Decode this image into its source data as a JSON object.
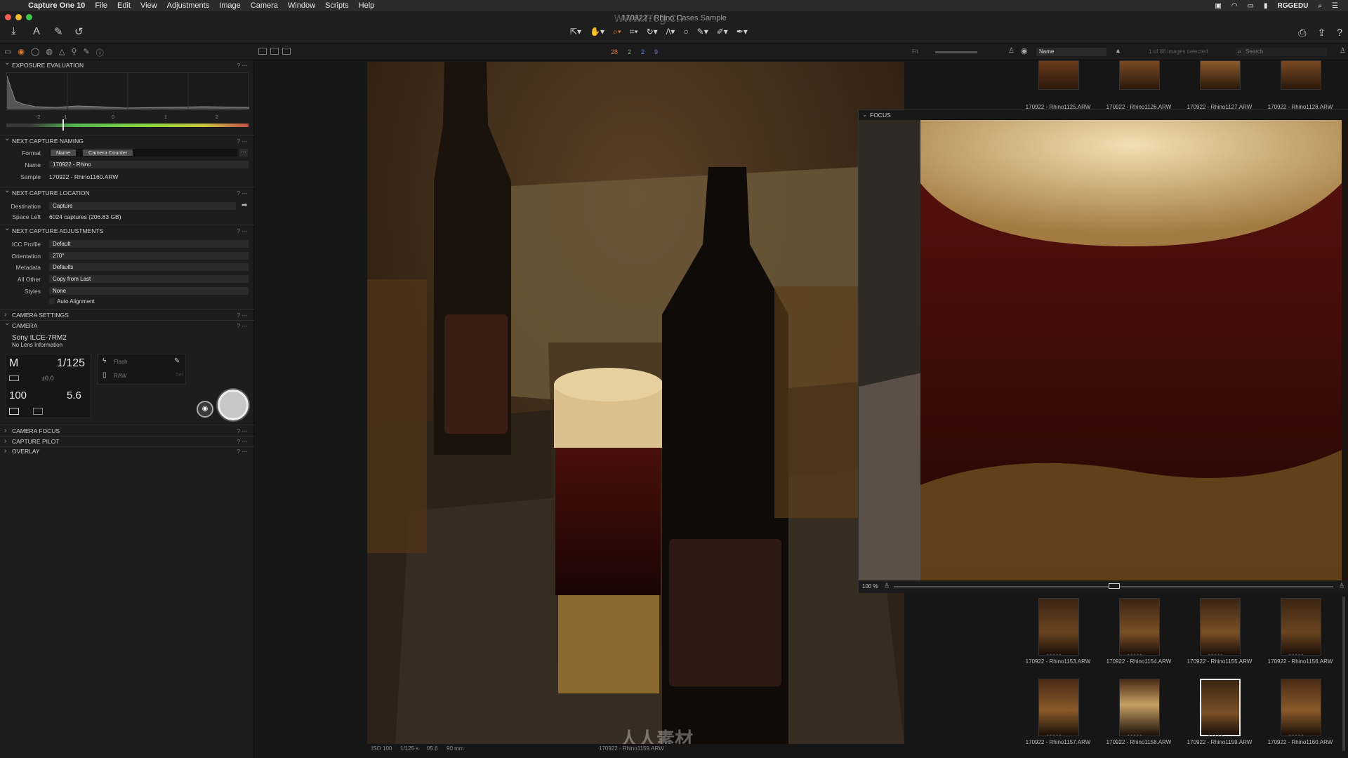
{
  "menubar": {
    "app_name": "Capture One 10",
    "items": [
      "File",
      "Edit",
      "View",
      "Adjustments",
      "Image",
      "Camera",
      "Window",
      "Scripts",
      "Help"
    ],
    "user": "RGGEDU"
  },
  "toolbar": {
    "window_title": "170922 - Rhino Cases Sample",
    "watermark": "www.rrcg.cn"
  },
  "tabbar": {
    "ratings": [
      {
        "value": "28",
        "color": "#e8783a"
      },
      {
        "value": "2",
        "color": "#5fbf4e"
      },
      {
        "value": "2",
        "color": "#4e8fd9"
      },
      {
        "value": "9",
        "color": "#8d6fd6"
      }
    ],
    "fit_label": "Fit",
    "sort_value": "Name",
    "selection_count": "1 of 88 images selected",
    "search_placeholder": "Search"
  },
  "exposure": {
    "title": "EXPOSURE EVALUATION",
    "scale": [
      "-2",
      "-1",
      "0",
      "1",
      "2"
    ]
  },
  "naming": {
    "title": "NEXT CAPTURE NAMING",
    "format_label": "Format",
    "format_tokens": [
      "Name",
      "Camera Counter"
    ],
    "name_label": "Name",
    "name_value": "170922 - Rhino",
    "sample_label": "Sample",
    "sample_value": "170922 - Rhino1160.ARW"
  },
  "location": {
    "title": "NEXT CAPTURE LOCATION",
    "destination_label": "Destination",
    "destination_value": "Capture",
    "space_label": "Space Left",
    "space_value": "6024 captures (206.83 GB)"
  },
  "adjustments": {
    "title": "NEXT CAPTURE ADJUSTMENTS",
    "rows": [
      {
        "label": "ICC Profile",
        "value": "Default"
      },
      {
        "label": "Orientation",
        "value": "270°"
      },
      {
        "label": "Metadata",
        "value": "Defaults"
      },
      {
        "label": "All Other",
        "value": "Copy from Last"
      },
      {
        "label": "Styles",
        "value": "None"
      }
    ],
    "auto_alignment": "Auto Alignment"
  },
  "camera_settings": {
    "title": "CAMERA SETTINGS"
  },
  "camera": {
    "title": "CAMERA",
    "model": "Sony ILCE-7RM2",
    "lens": "No Lens Information",
    "mode": "M",
    "shutter": "1/125",
    "exposure_comp": "±0.0",
    "iso": "100",
    "aperture": "5.6",
    "flash": "Flash",
    "raw": "RAW",
    "sel": "Sel"
  },
  "collapsed_sections": [
    "CAMERA FOCUS",
    "CAPTURE PILOT",
    "OVERLAY"
  ],
  "viewer": {
    "iso": "ISO 100",
    "shutter": "1/125 s",
    "aperture": "f/5.6",
    "focal": "90 mm",
    "filename": "170922 - Rhino1159.ARW",
    "watermark": "人人素材"
  },
  "focus": {
    "title": "FOCUS",
    "zoom": "100 %"
  },
  "browser": {
    "top_row": [
      "170922 - Rhino1125.ARW",
      "170922 - Rhino1126.ARW",
      "170922 - Rhino1127.ARW",
      "170922 - Rhino1128.ARW"
    ],
    "row1": [
      "170922 - Rhino1153.ARW",
      "170922 - Rhino1154.ARW",
      "170922 - Rhino1155.ARW",
      "170922 - Rhino1156.ARW"
    ],
    "row2": [
      "170922 - Rhino1157.ARW",
      "170922 - Rhino1158.ARW",
      "170922 - Rhino1159.ARW",
      "170922 - Rhino1160.ARW"
    ],
    "selected": "170922 - Rhino1159.ARW"
  },
  "colors": {
    "accent": "#e07a2f",
    "panel_bg": "#1d1d1d",
    "field_bg": "#2b2b2b"
  }
}
